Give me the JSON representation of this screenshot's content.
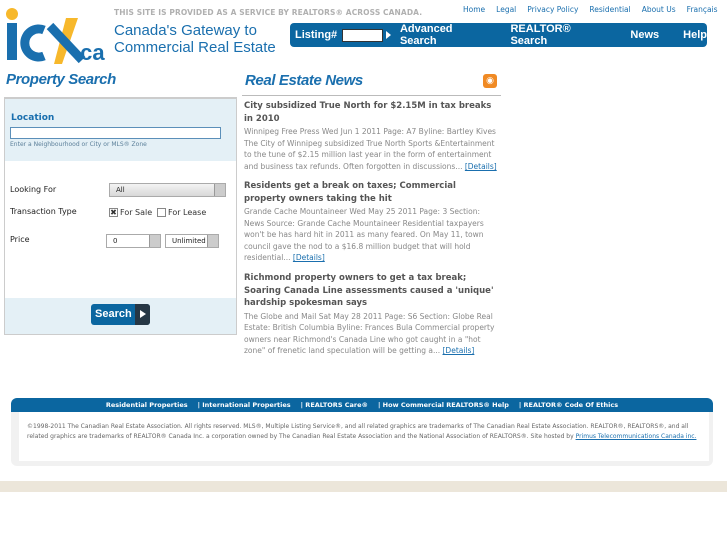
{
  "header": {
    "logo_text": "icx.ca",
    "notice": "THIS SITE IS PROVIDED AS A SERVICE BY REALTORS® ACROSS CANADA.",
    "tagline_1": "Canada's Gateway to",
    "tagline_2": "Commercial Real Estate",
    "top_links": [
      "Home",
      "Legal",
      "Privacy Policy",
      "Residential",
      "About Us",
      "Français"
    ]
  },
  "nav": {
    "listing_label": "Listing#",
    "listing_value": "",
    "items": [
      "Advanced Search",
      "REALTOR® Search",
      "News",
      "Help"
    ]
  },
  "search": {
    "title": "Property Search",
    "location_label": "Location",
    "location_value": "",
    "location_hint": "Enter a Neighbourhood or City or MLS® Zone",
    "looking_for_label": "Looking For",
    "looking_for_value": "All",
    "transaction_label": "Transaction Type",
    "for_sale": "For Sale",
    "for_sale_checked": true,
    "for_lease": "For Lease",
    "for_lease_checked": false,
    "price_label": "Price",
    "price_min": "0",
    "price_max": "Unlimited",
    "button": "Search"
  },
  "news": {
    "title": "Real Estate News",
    "rss_icon": "rss-icon",
    "details_label": "[Details]",
    "items": [
      {
        "title": "City subsidized True North for $2.15M in tax breaks in 2010",
        "body": "Winnipeg Free Press Wed Jun 1 2011 Page: A7 Byline: Bartley Kives The City of Winnipeg subsidized True North Sports &Entertainment to the tune of $2.15 million last year in the form of entertainment and business tax refunds. Often forgotten in discussions..."
      },
      {
        "title": "Residents get a break on taxes; Commercial property owners taking the hit",
        "body": "Grande Cache Mountaineer Wed May 25 2011 Page: 3 Section: News Source: Grande Cache Mountaineer Residential taxpayers won't be has hard hit in 2011 as many feared. On May 11, town council gave the nod to a $16.8 million budget that will hold residential..."
      },
      {
        "title": "Richmond property owners to get a tax break; Soaring Canada Line assessments caused a 'unique' hardship spokesman says",
        "body": "The Globe and Mail Sat May 28 2011 Page: S6 Section: Globe Real Estate: British Columbia Byline: Frances Bula Commercial property owners near Richmond's Canada Line who got caught in a \"hot zone\" of frenetic land speculation will be getting a..."
      }
    ]
  },
  "footer": {
    "links": [
      "Residential Properties",
      "| International Properties",
      "| REALTORS Care®",
      "| How Commercial REALTORS® Help",
      "| REALTOR® Code Of Ethics"
    ],
    "copyright": "©1998-2011 The Canadian Real Estate Association. All rights reserved. MLS®, Multiple Listing Service®, and all related graphics are trademarks of The Canadian Real Estate Association. REALTOR®, REALTORS®, and all related graphics are trademarks of REALTOR® Canada Inc. a corporation owned by The Canadian Real Estate Association and the National Association of REALTORS®. Site hosted by ",
    "host_link": "Primus Telecommunications Canada inc."
  },
  "colors": {
    "brand_blue": "#0b66a0",
    "logo_yellow": "#f7b82b",
    "rss": "#f08a24"
  }
}
